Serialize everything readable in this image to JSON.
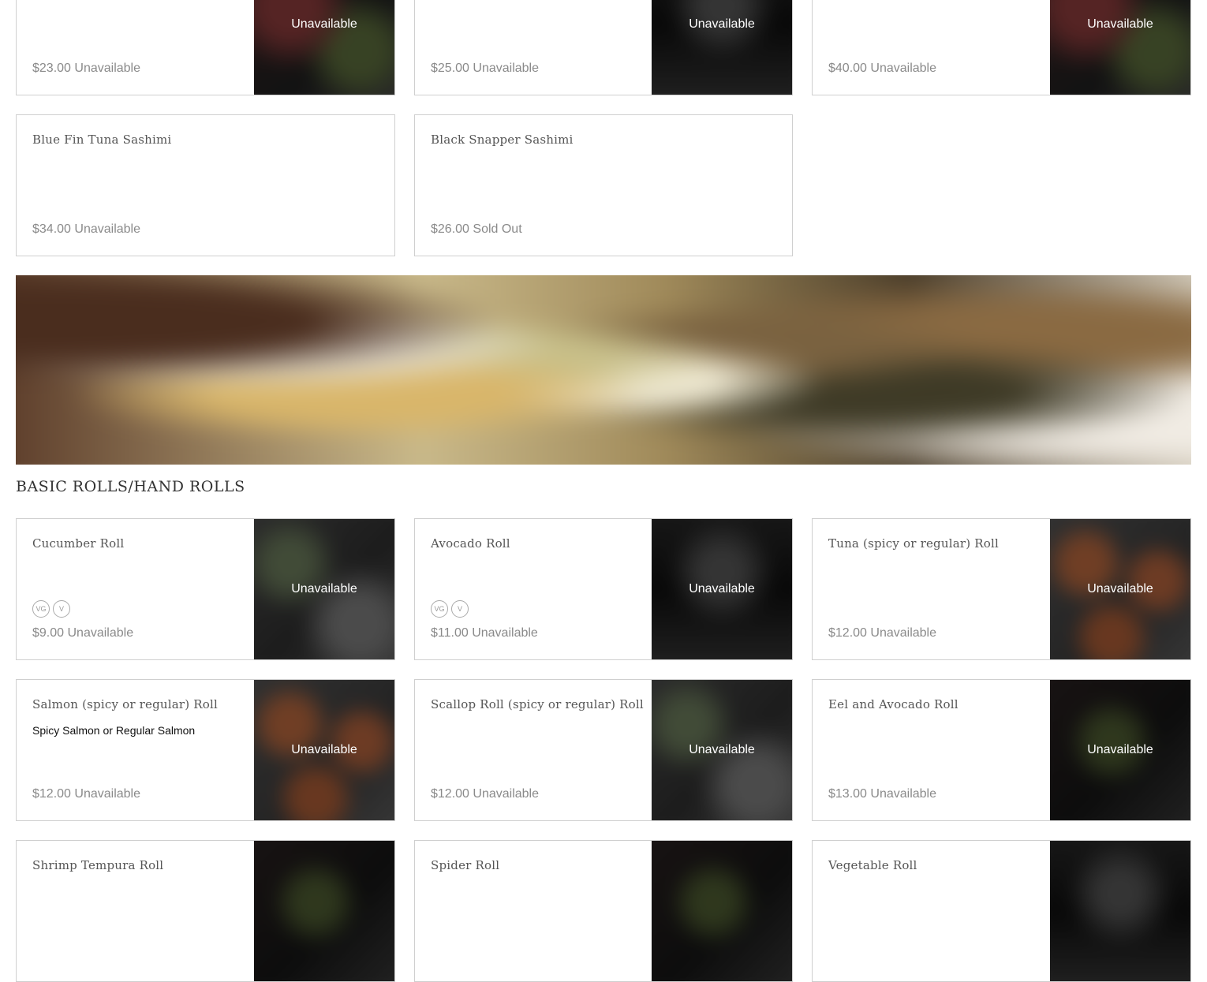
{
  "items_top": [
    {
      "price": "$23.00",
      "status": "Unavailable",
      "image_status": "Unavailable"
    },
    {
      "price": "$25.00",
      "status": "Unavailable",
      "image_status": "Unavailable"
    },
    {
      "price": "$40.00",
      "status": "Unavailable",
      "image_status": "Unavailable"
    }
  ],
  "sashimi": [
    {
      "name": "Blue Fin Tuna Sashimi",
      "price": "$34.00",
      "status": "Unavailable"
    },
    {
      "name": "Black Snapper Sashimi",
      "price": "$26.00",
      "status": "Sold Out"
    }
  ],
  "section": {
    "title": "BASIC ROLLS/HAND ROLLS"
  },
  "rolls": [
    {
      "name": "Cucumber Roll",
      "price": "$9.00",
      "status": "Unavailable",
      "image_status": "Unavailable",
      "badges": [
        "VG",
        "V"
      ]
    },
    {
      "name": "Avocado Roll",
      "price": "$11.00",
      "status": "Unavailable",
      "image_status": "Unavailable",
      "badges": [
        "VG",
        "V"
      ]
    },
    {
      "name": "Tuna (spicy or regular) Roll",
      "price": "$12.00",
      "status": "Unavailable",
      "image_status": "Unavailable"
    },
    {
      "name": "Salmon (spicy or regular) Roll",
      "description": "Spicy Salmon or Regular Salmon",
      "price": "$12.00",
      "status": "Unavailable",
      "image_status": "Unavailable"
    },
    {
      "name": "Scallop Roll (spicy or regular) Roll",
      "price": "$12.00",
      "status": "Unavailable",
      "image_status": "Unavailable"
    },
    {
      "name": "Eel and Avocado Roll",
      "price": "$13.00",
      "status": "Unavailable",
      "image_status": "Unavailable"
    },
    {
      "name": "Shrimp Tempura Roll"
    },
    {
      "name": "Spider Roll"
    },
    {
      "name": "Vegetable Roll"
    }
  ]
}
